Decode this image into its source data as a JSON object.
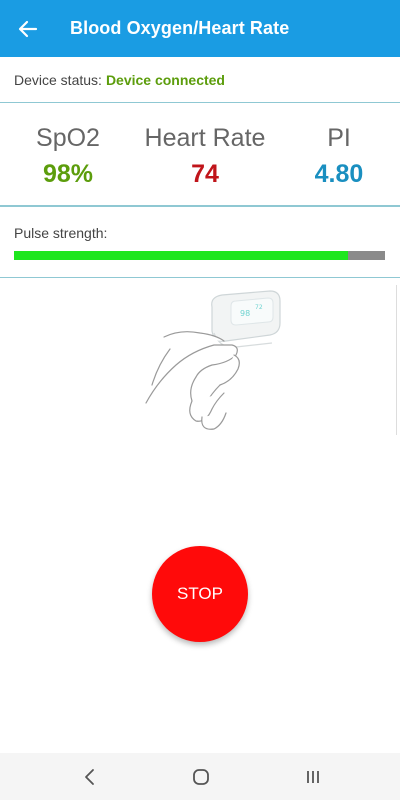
{
  "appbar": {
    "title": "Blood Oxygen/Heart Rate",
    "back_icon": "arrow-left-icon"
  },
  "status": {
    "label": "Device status:",
    "value": "Device connected",
    "value_color": "#5c9d0c"
  },
  "metrics": {
    "spo2": {
      "label": "SpO2",
      "value": "98%",
      "color": "#5c9d0c"
    },
    "heart_rate": {
      "label": "Heart Rate",
      "value": "74",
      "color": "#c0141a"
    },
    "pi": {
      "label": "PI",
      "value": "4.80",
      "color": "#1a8fc0"
    }
  },
  "pulse": {
    "label": "Pulse strength:",
    "level_percent": 90,
    "fill_color": "#1ee61e",
    "track_color": "#8a8a8a"
  },
  "illustration": {
    "icon": "finger-oximeter-illustration"
  },
  "stop_button": {
    "label": "STOP",
    "color": "#ff0a0a"
  },
  "navbar": {
    "items": [
      "back-nav-icon",
      "home-nav-icon",
      "recents-nav-icon"
    ]
  },
  "colors": {
    "accent": "#1a9ce3",
    "divider": "#8fc8d3"
  }
}
